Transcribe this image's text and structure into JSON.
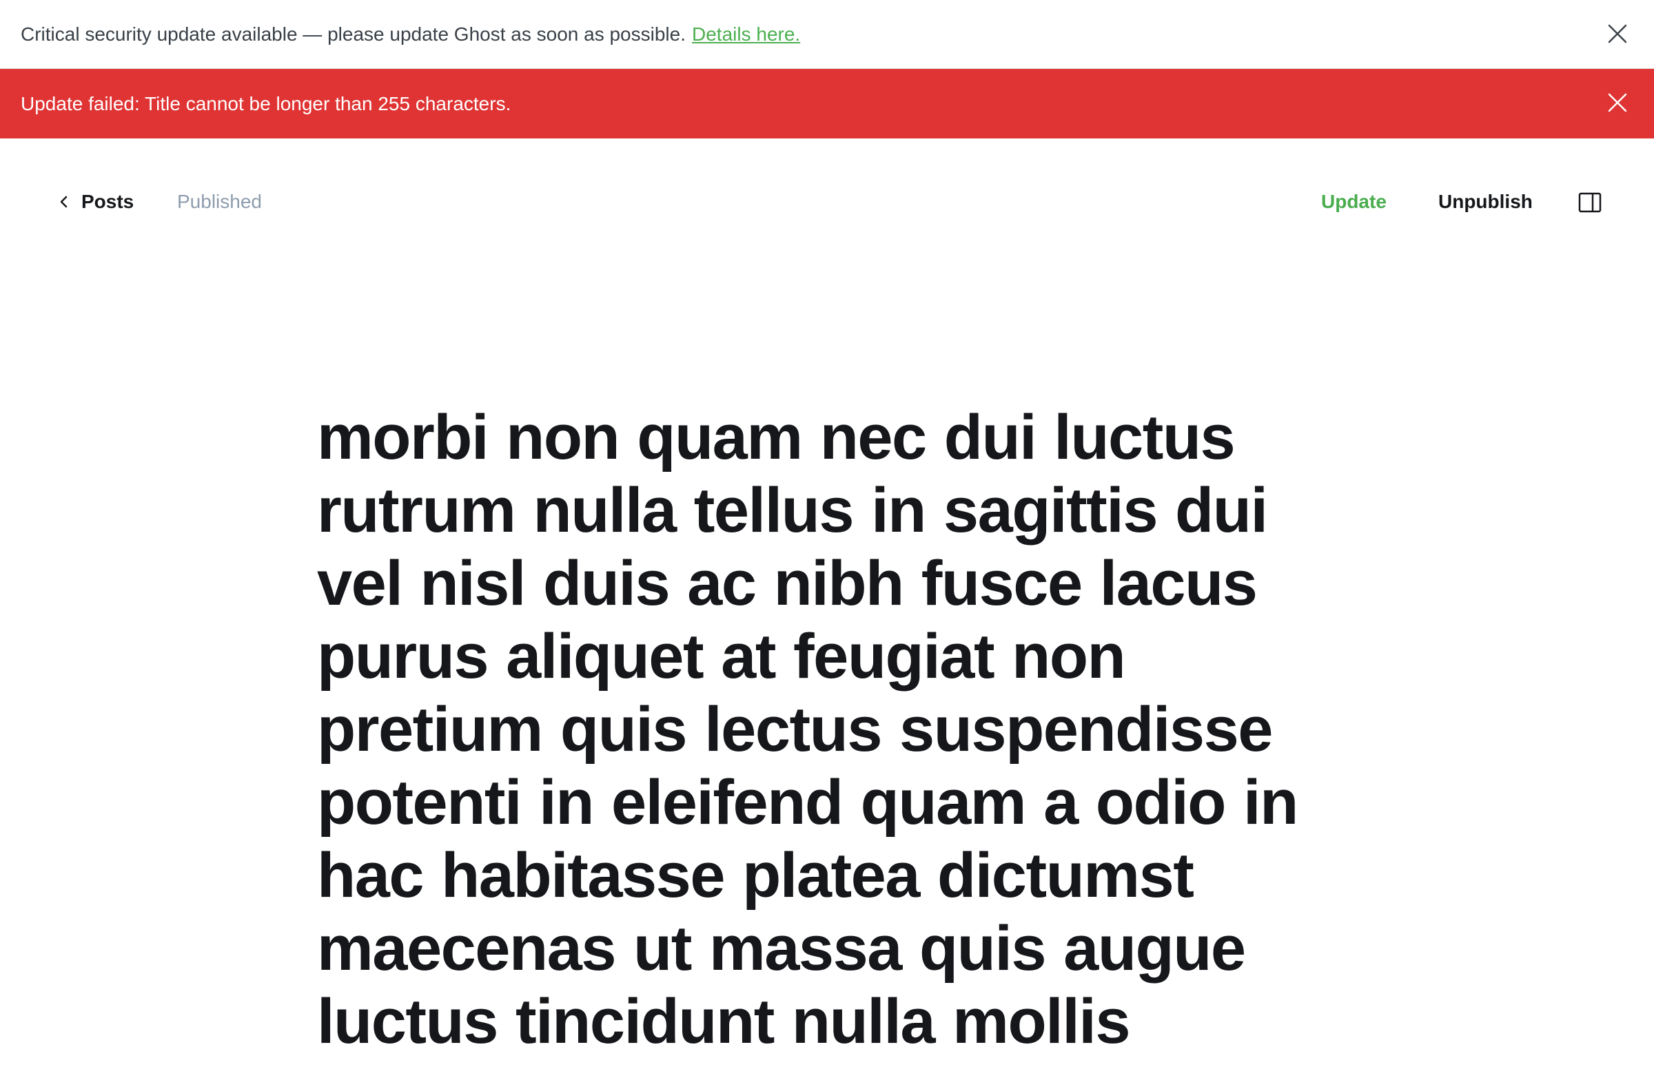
{
  "security_banner": {
    "message": "Critical security update available — please update Ghost as soon as possible.",
    "link_text": "Details here."
  },
  "error_alert": {
    "message": "Update failed: Title cannot be longer than 255 characters."
  },
  "header": {
    "back_label": "Posts",
    "status": "Published",
    "update_label": "Update",
    "unpublish_label": "Unpublish"
  },
  "post": {
    "title": "morbi non quam nec dui luctus rutrum nulla tellus in sagittis dui vel nisl duis ac nibh fusce lacus purus aliquet at feugiat non pretium quis lectus suspendisse potenti in eleifend quam a odio in hac habitasse platea dictumst maecenas ut massa quis augue luctus tincidunt nulla mollis"
  },
  "icons": {
    "close": "close-icon",
    "back": "chevron-left-icon",
    "sidebar": "sidebar-panel-icon"
  },
  "colors": {
    "error": "#e03434",
    "accent_green": "#4aad4e",
    "muted": "#8e9cac"
  }
}
